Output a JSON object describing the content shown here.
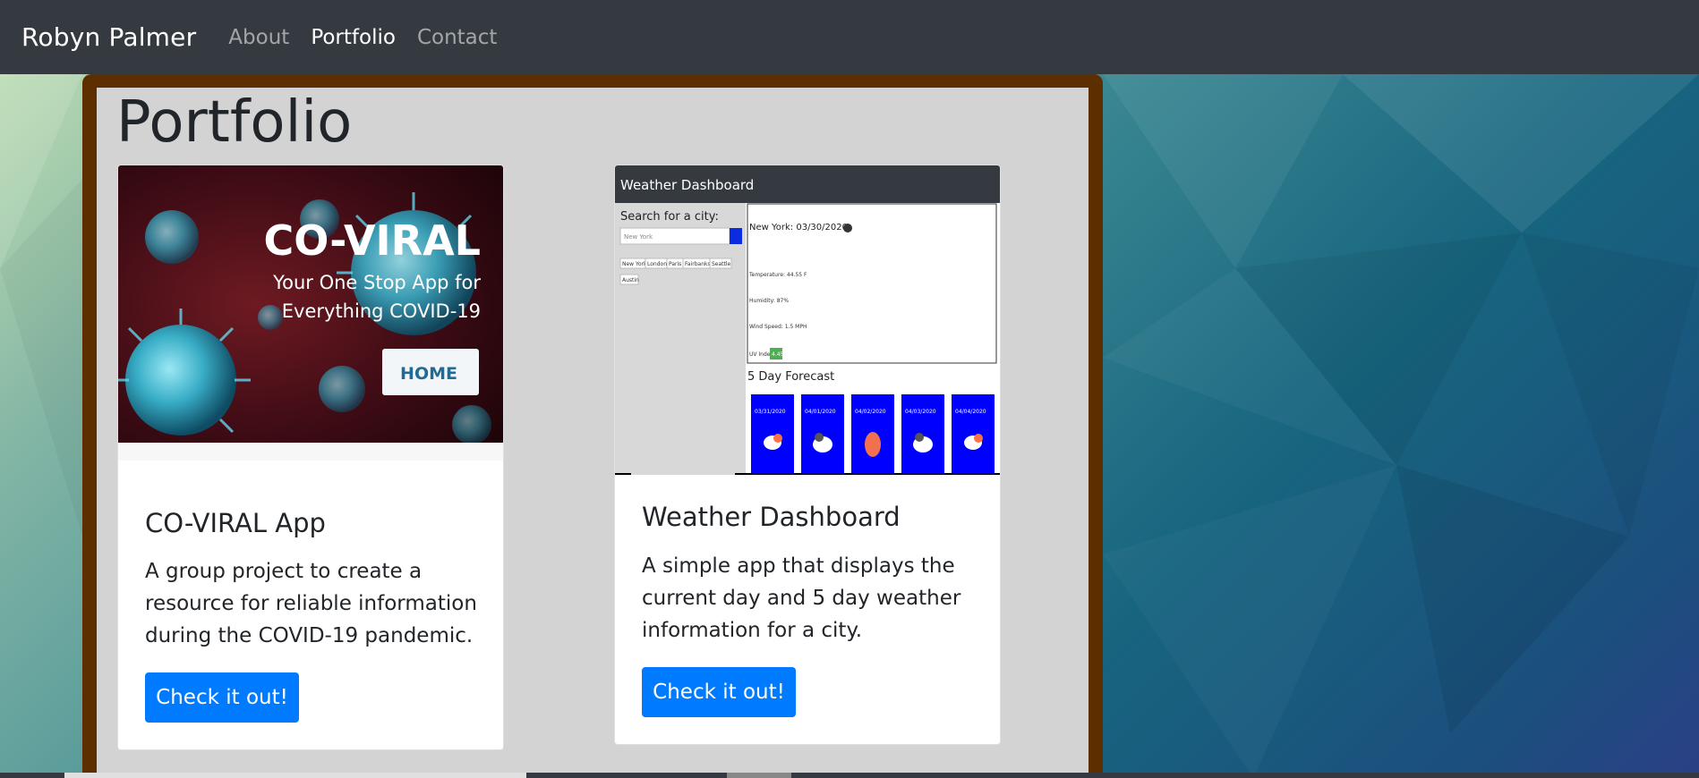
{
  "nav": {
    "brand": "Robyn Palmer",
    "links": [
      {
        "label": "About",
        "active": false
      },
      {
        "label": "Portfolio",
        "active": true
      },
      {
        "label": "Contact",
        "active": false
      }
    ]
  },
  "page": {
    "title": "Portfolio"
  },
  "cards": [
    {
      "image": {
        "title": "CO-VIRAL",
        "subtitle_line1": "Your One Stop App for",
        "subtitle_line2": "Everything COVID-19",
        "button": "HOME"
      },
      "title": "CO-VIRAL App",
      "text": "A group project to create a resource for reliable information during the COVID-19 pandemic.",
      "button": "Check it out!"
    },
    {
      "image": {
        "header": "Weather Dashboard",
        "search_label": "Search for a city:",
        "search_placeholder": "New York",
        "cities": [
          "New York",
          "London",
          "Paris",
          "Fairbanks",
          "Seattle",
          "Austin"
        ],
        "current_city": "New York: 03/30/2020",
        "temperature": "Temperature: 44.55 F",
        "humidity": "Humidity: 87%",
        "wind": "Wind Speed: 1.5 MPH",
        "uv_label": "UV Index:",
        "uv_value": "4.45",
        "forecast_title": "5 Day Forecast",
        "forecast_dates": [
          "03/31/2020",
          "04/01/2020",
          "04/02/2020",
          "04/03/2020",
          "04/04/2020"
        ]
      },
      "title": "Weather Dashboard",
      "text": "A simple app that displays the current day and 5 day weather information for a city.",
      "button": "Check it out!"
    }
  ],
  "colors": {
    "navbar": "#343a40",
    "frame": "#5c2e00",
    "panel": "#d3d3d3",
    "primary": "#007bff",
    "forecast_card": "#0000ff",
    "uv_badge": "#4caf50"
  }
}
